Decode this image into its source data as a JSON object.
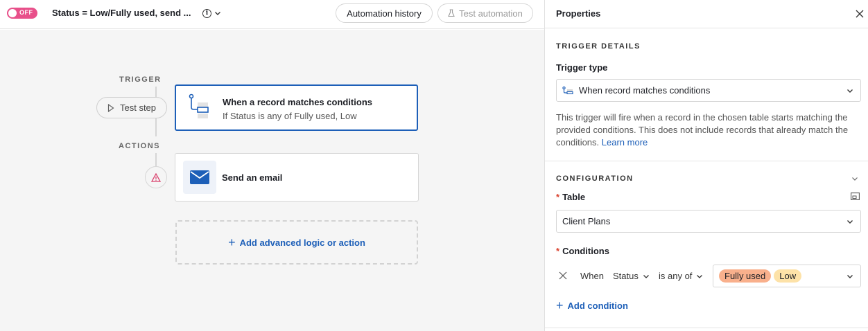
{
  "topbar": {
    "toggle_label": "OFF",
    "automation_title": "Status = Low/Fully used, send ...",
    "automation_history": "Automation history",
    "test_automation": "Test automation"
  },
  "canvas": {
    "trigger_label": "TRIGGER",
    "actions_label": "ACTIONS",
    "test_step": "Test step",
    "trigger_card": {
      "title": "When a record matches conditions",
      "subtitle": "If Status is any of Fully used, Low"
    },
    "email_card": {
      "title": "Send an email"
    },
    "add_logic": "Add advanced logic or action"
  },
  "panel": {
    "title": "Properties",
    "trigger_details": "TRIGGER DETAILS",
    "trigger_type_label": "Trigger type",
    "trigger_type_value": "When record matches conditions",
    "description": "This trigger will fire when a record in the chosen table starts matching the provided conditions. This does not include records that already match the conditions.",
    "learn_more": "Learn more",
    "configuration": "CONFIGURATION",
    "table_label": "Table",
    "table_value": "Client Plans",
    "conditions_label": "Conditions",
    "condition": {
      "when": "When",
      "field": "Status",
      "operator": "is any of",
      "values": [
        "Fully used",
        "Low"
      ]
    },
    "add_condition": "Add condition"
  },
  "colors": {
    "accent": "#1d5fb8",
    "toggle_off": "#e8508a",
    "pill_fully_used": "#f9b08c",
    "pill_low": "#fde2a8",
    "required": "#d93f2b"
  }
}
